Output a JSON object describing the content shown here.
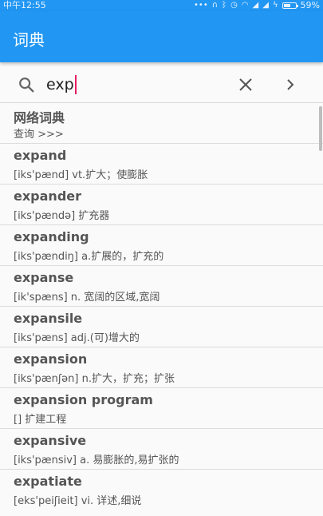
{
  "status": {
    "time": "中午12:55",
    "battery_percent": "59%",
    "battery_level": 0.59
  },
  "app": {
    "title": "词典"
  },
  "search": {
    "query": "exp"
  },
  "online": {
    "title": "网络词典",
    "subtitle": "查询 >>>"
  },
  "results": [
    {
      "word": "expand",
      "meaning": "[iks'pænd] vt.扩大；使膨胀"
    },
    {
      "word": "expander",
      "meaning": "[iks'pændə] 扩充器"
    },
    {
      "word": "expanding",
      "meaning": "[iks'pændiŋ] a.扩展的，扩充的"
    },
    {
      "word": "expanse",
      "meaning": "[ik'spæns] n. 宽阔的区域,宽阔"
    },
    {
      "word": "expansile",
      "meaning": "[iks'pæns] adj.(可)增大的"
    },
    {
      "word": "expansion",
      "meaning": "[iks'pænʃən] n.扩大，扩充；扩张"
    },
    {
      "word": "expansion program",
      "meaning": "[] 扩建工程"
    },
    {
      "word": "expansive",
      "meaning": "[iks'pænsiv] a. 易膨胀的,易扩张的"
    },
    {
      "word": "expatiate",
      "meaning": "[eks'peiʃieit] vi. 详述,细说"
    }
  ],
  "icons": {
    "search": "search-icon",
    "clear": "close-icon",
    "next": "chevron-right-icon"
  }
}
